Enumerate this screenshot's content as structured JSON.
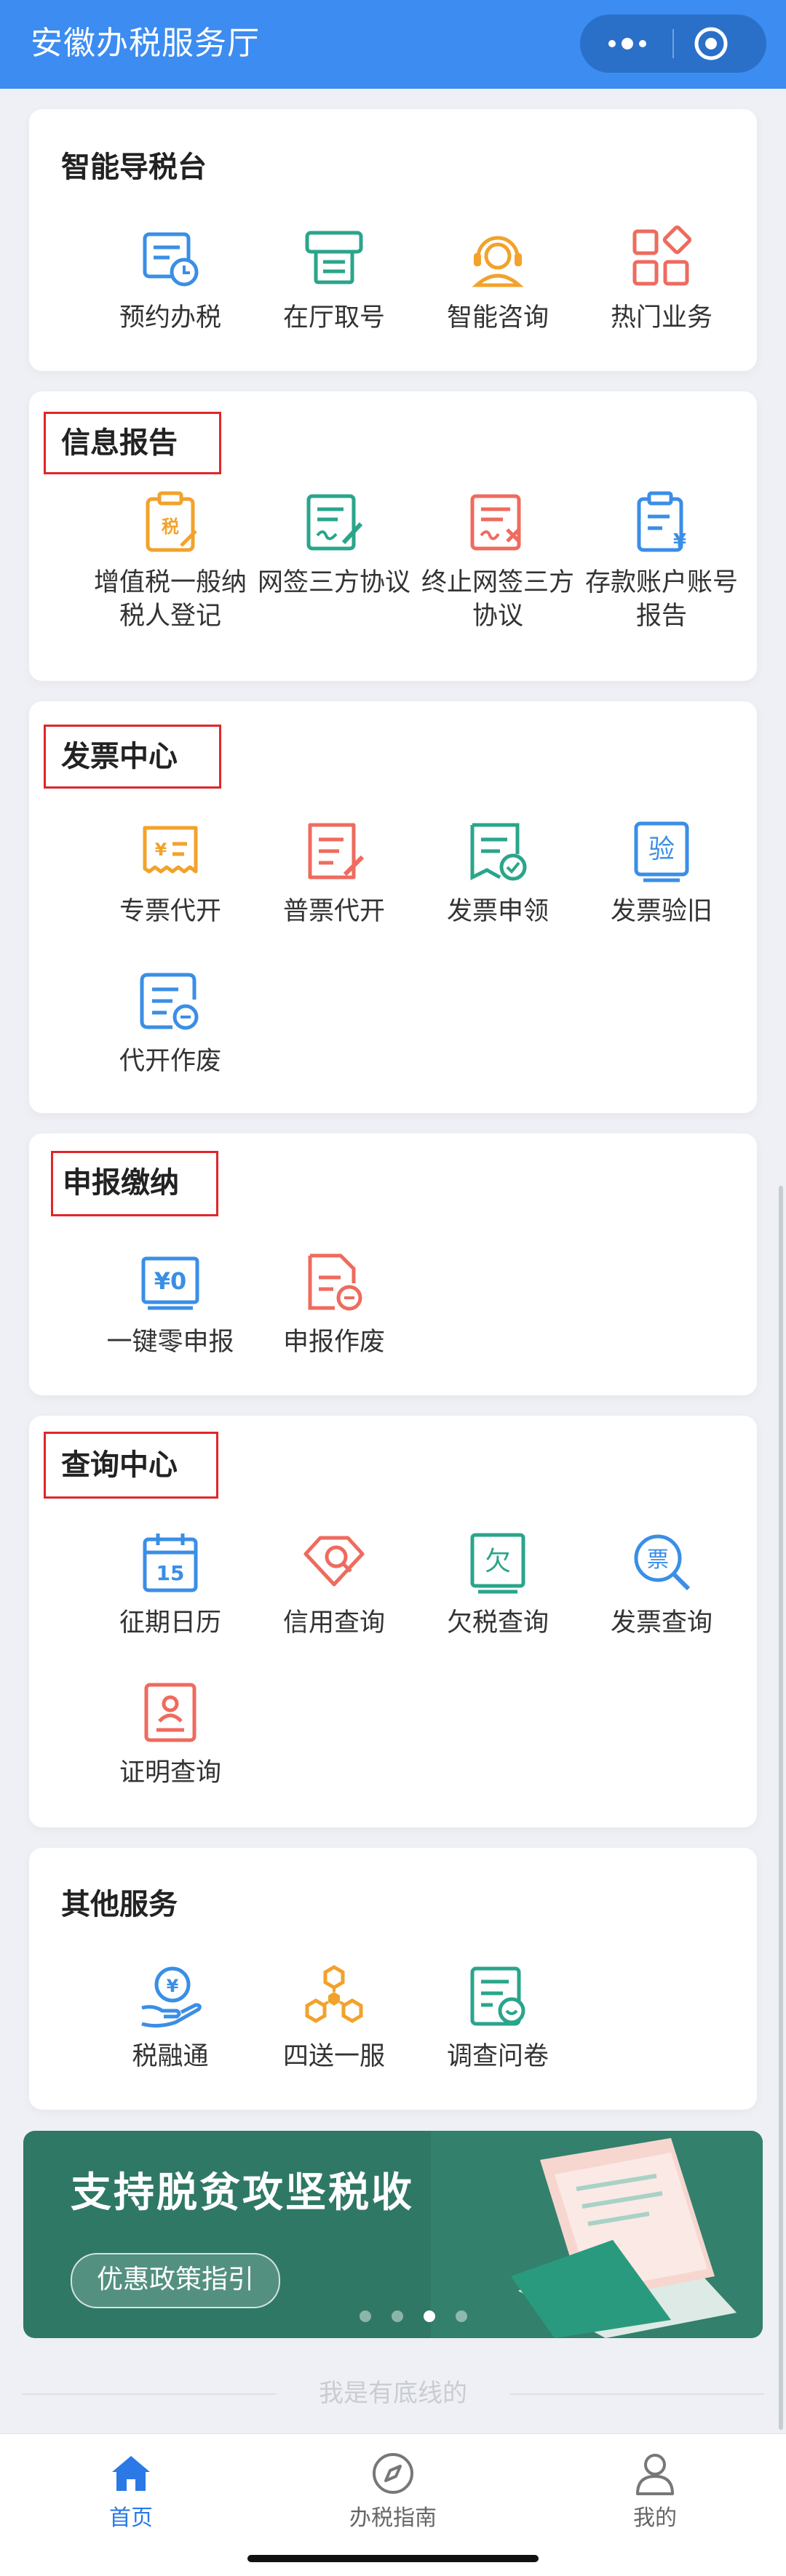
{
  "header": {
    "title": "安徽办税服务厅",
    "more_icon": "more-dots-icon",
    "close_icon": "target-close-icon"
  },
  "sections": {
    "smart": {
      "title": "智能导税台",
      "items": [
        {
          "label": "预约办税",
          "icon": "calendar-clock-icon"
        },
        {
          "label": "在厅取号",
          "icon": "ticket-printer-icon"
        },
        {
          "label": "智能咨询",
          "icon": "headset-agent-icon"
        },
        {
          "label": "热门业务",
          "icon": "grid-apps-icon"
        }
      ]
    },
    "info": {
      "title": "信息报告",
      "items": [
        {
          "label": "增值税一般纳\n税人登记",
          "icon": "tax-clipboard-icon"
        },
        {
          "label": "网签三方协议",
          "icon": "sign-document-icon"
        },
        {
          "label": "终止网签三方\n协议",
          "icon": "cancel-sign-icon"
        },
        {
          "label": "存款账户账号\n报告",
          "icon": "yuan-report-icon"
        }
      ]
    },
    "invoice": {
      "title": "发票中心",
      "items": [
        {
          "label": "专票代开",
          "icon": "special-invoice-icon"
        },
        {
          "label": "普票代开",
          "icon": "normal-invoice-icon"
        },
        {
          "label": "发票申领",
          "icon": "invoice-apply-icon"
        },
        {
          "label": "发票验旧",
          "icon": "invoice-verify-icon"
        },
        {
          "label": "代开作废",
          "icon": "invoice-void-icon"
        }
      ]
    },
    "declare": {
      "title": "申报缴纳",
      "items": [
        {
          "label": "一键零申报",
          "icon": "zero-declare-icon"
        },
        {
          "label": "申报作废",
          "icon": "declare-void-icon"
        }
      ]
    },
    "query": {
      "title": "查询中心",
      "items": [
        {
          "label": "征期日历",
          "icon": "calendar-15-icon"
        },
        {
          "label": "信用查询",
          "icon": "credit-search-icon"
        },
        {
          "label": "欠税查询",
          "icon": "owed-tax-icon"
        },
        {
          "label": "发票查询",
          "icon": "invoice-search-icon"
        },
        {
          "label": "证明查询",
          "icon": "certificate-icon"
        }
      ]
    },
    "other": {
      "title": "其他服务",
      "items": [
        {
          "label": "税融通",
          "icon": "finance-hand-icon"
        },
        {
          "label": "四送一服",
          "icon": "hexagon-network-icon"
        },
        {
          "label": "调查问卷",
          "icon": "survey-icon"
        }
      ]
    }
  },
  "banner": {
    "title": "支持脱贫攻坚税收",
    "button": "优惠政策指引",
    "active_dot": 3,
    "dot_count": 4
  },
  "footer_text": "我是有底线的",
  "tabbar": {
    "home": "首页",
    "guide": "办税指南",
    "mine": "我的"
  },
  "colors": {
    "brand": "#3c8cf1",
    "blue": "#3a8ee6",
    "teal": "#2aa58b",
    "orange": "#f2a22b",
    "red": "#ee6b5e",
    "banner": "#2f7865"
  }
}
